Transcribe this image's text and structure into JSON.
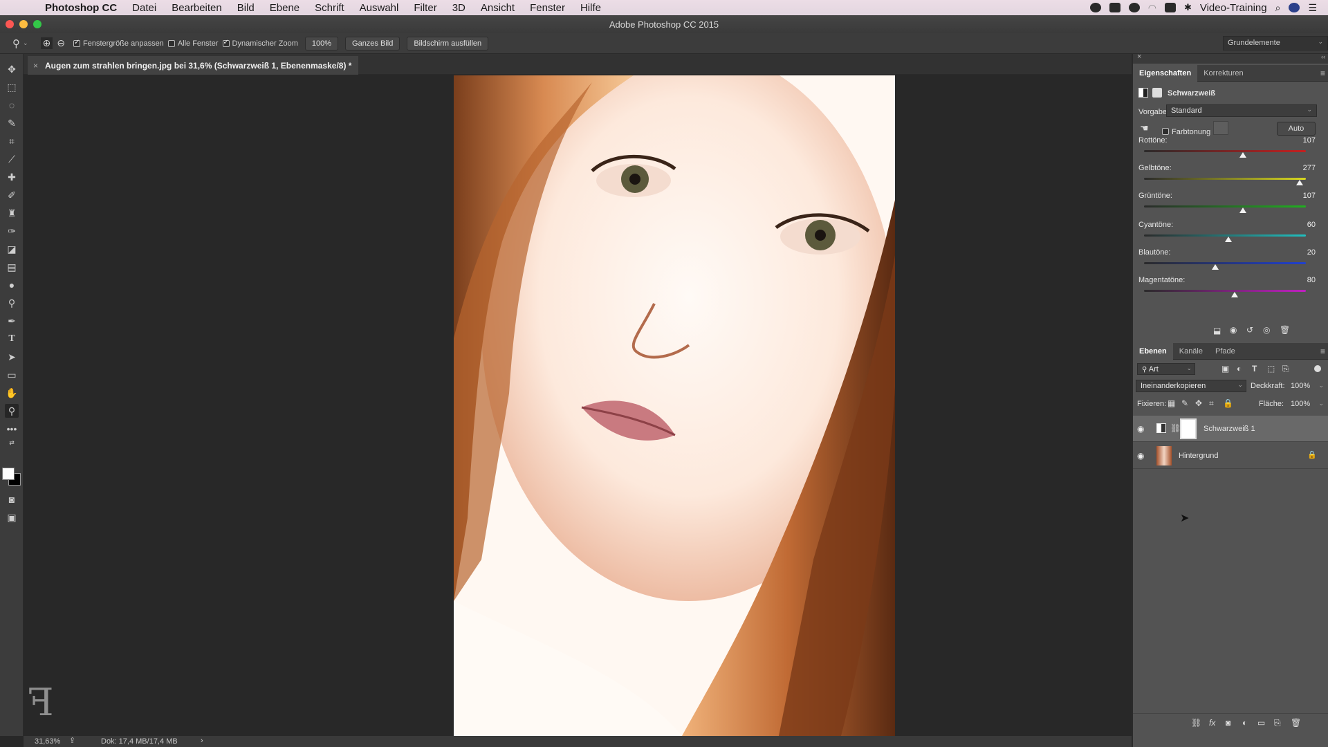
{
  "menubar": {
    "app": "Photoshop CC",
    "items": [
      "Datei",
      "Bearbeiten",
      "Bild",
      "Ebene",
      "Schrift",
      "Auswahl",
      "Filter",
      "3D",
      "Ansicht",
      "Fenster",
      "Hilfe"
    ],
    "user": "Video-Training"
  },
  "window": {
    "title": "Adobe Photoshop CC 2015"
  },
  "options": {
    "fit_window": "Fenstergröße anpassen",
    "all_windows": "Alle Fenster",
    "dynamic_zoom": "Dynamischer Zoom",
    "zoom_value": "100%",
    "fit_screen": "Ganzes Bild",
    "fill_screen": "Bildschirm ausfüllen",
    "workspace": "Grundelemente"
  },
  "document": {
    "tab_title": "Augen zum strahlen bringen.jpg bei 31,6% (Schwarzweiß 1, Ebenenmaske/8) *"
  },
  "status": {
    "zoom": "31,63%",
    "doc_size": "Dok: 17,4 MB/17,4 MB"
  },
  "properties": {
    "tabs": [
      "Eigenschaften",
      "Korrekturen"
    ],
    "adjustment_name": "Schwarzweiß",
    "preset_label": "Vorgabe:",
    "preset_value": "Standard",
    "tint_label": "Farbtonung",
    "auto_label": "Auto",
    "sliders": [
      {
        "label": "Rottöne:",
        "value": "107",
        "fraction": 0.61
      },
      {
        "label": "Gelbtöne:",
        "value": "277",
        "fraction": 0.96
      },
      {
        "label": "Grüntöne:",
        "value": "107",
        "fraction": 0.61
      },
      {
        "label": "Cyantöne:",
        "value": "60",
        "fraction": 0.52
      },
      {
        "label": "Blautöne:",
        "value": "20",
        "fraction": 0.44
      },
      {
        "label": "Magentatöne:",
        "value": "80",
        "fraction": 0.56
      }
    ]
  },
  "layers": {
    "tabs": [
      "Ebenen",
      "Kanäle",
      "Pfade"
    ],
    "filter": "Art",
    "blend_mode": "Ineinanderkopieren",
    "opacity_label": "Deckkraft:",
    "opacity_value": "100%",
    "lock_label": "Fixieren:",
    "fill_label": "Fläche:",
    "fill_value": "100%",
    "items": [
      {
        "name": "Schwarzweiß 1"
      },
      {
        "name": "Hintergrund"
      }
    ]
  },
  "colors": {
    "accent": "#e8e8e8",
    "panel_bg": "#535353"
  }
}
